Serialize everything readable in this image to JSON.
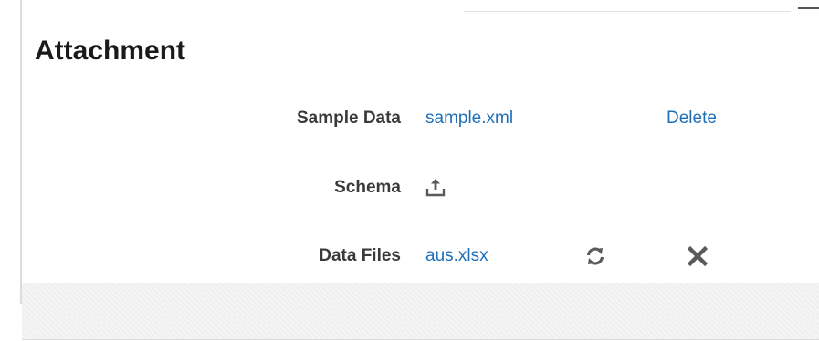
{
  "section": {
    "title": "Attachment"
  },
  "rows": [
    {
      "label": "Sample Data",
      "link": "sample.xml",
      "action": "Delete"
    },
    {
      "label": "Schema",
      "icon": "upload-icon"
    },
    {
      "label": "Data Files",
      "link": "aus.xlsx",
      "icons": [
        "refresh-icon",
        "close-icon"
      ]
    }
  ],
  "colors": {
    "link": "#1f6fb8",
    "label": "#3a3a3a",
    "title": "#1a1a1a",
    "icon": "#5a5a5a"
  }
}
